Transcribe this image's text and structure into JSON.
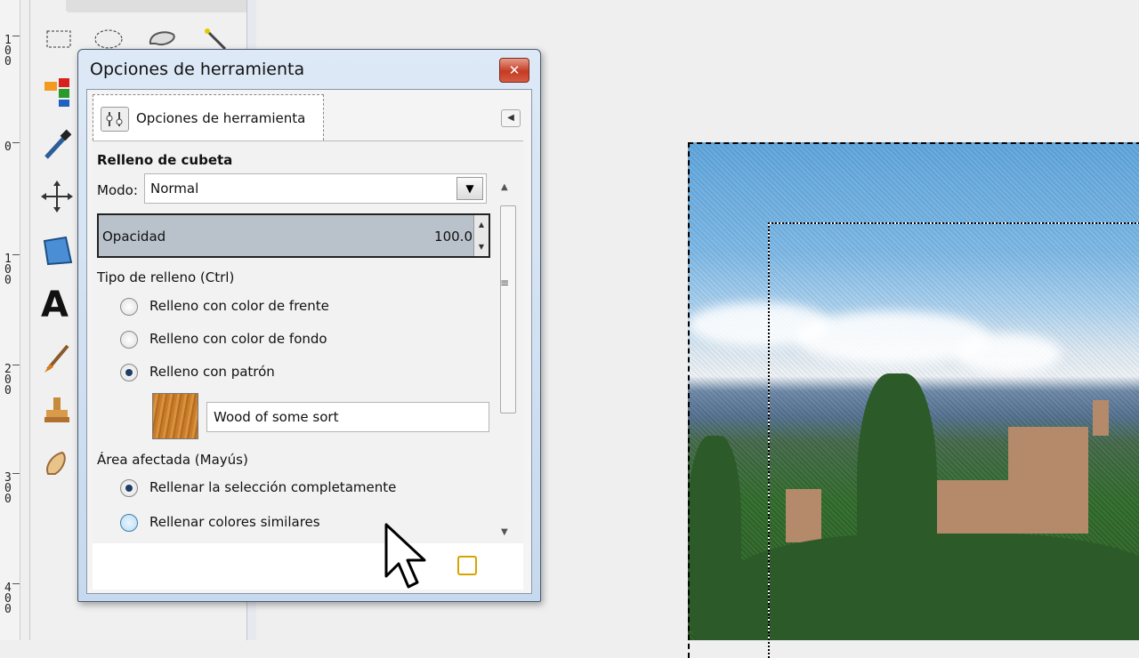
{
  "ruler": {
    "labels": [
      "100",
      "0",
      "100",
      "200",
      "300",
      "400"
    ]
  },
  "toolbox": {
    "tools": [
      "rect-select-icon",
      "ellipse-select-icon",
      "free-select-icon",
      "fuzzy-select-icon",
      "color-select-icon",
      "color-picker-icon",
      "move-icon",
      "perspective-icon",
      "text-icon",
      "paintbrush-icon",
      "clone-icon",
      "smudge-icon"
    ]
  },
  "dialog": {
    "title": "Opciones de herramienta",
    "tab_label": "Opciones de herramienta",
    "section_title": "Relleno de cubeta",
    "mode": {
      "label": "Modo:",
      "value": "Normal"
    },
    "opacity": {
      "label": "Opacidad",
      "value": "100.0"
    },
    "fill_type": {
      "label": "Tipo de relleno  (Ctrl)",
      "options": [
        "Relleno con color de frente",
        "Relleno con color de fondo",
        "Relleno con patrón"
      ],
      "selected": "Relleno con patrón"
    },
    "pattern": {
      "name": "Wood of some sort"
    },
    "affected_area": {
      "label": "Área afectada  (Mayús)",
      "options": [
        "Rellenar la selección completamente",
        "Rellenar colores similares"
      ],
      "selected": "Rellenar la selección completamente"
    }
  },
  "colors": {
    "accent": "#1d3d66",
    "close_button": "#c43b23",
    "opacity_bar": "#b9c2cb"
  }
}
